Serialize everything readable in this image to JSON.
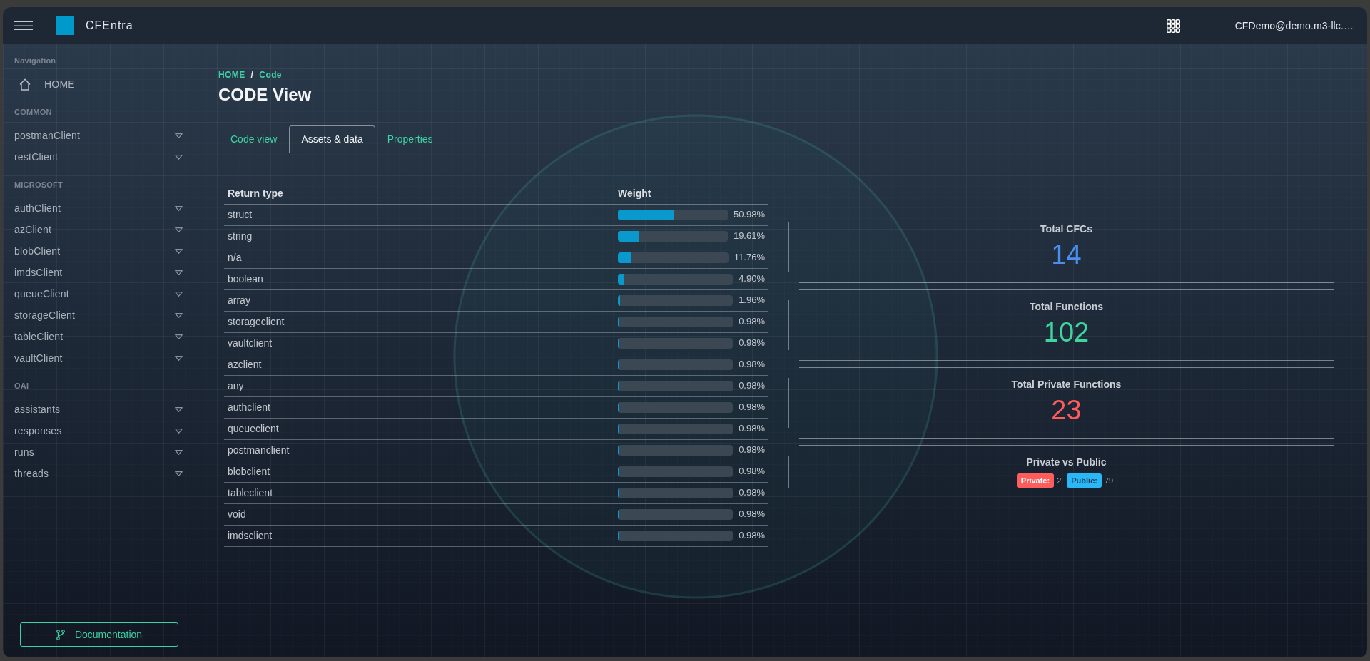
{
  "topbar": {
    "app_name": "CFEntra",
    "user": "CFDemo@demo.m3-llc.…"
  },
  "sidebar": {
    "sections": [
      {
        "heading": "Navigation",
        "items": [
          {
            "label": "HOME",
            "kind": "link"
          }
        ]
      },
      {
        "heading": "COMMON",
        "items": [
          {
            "label": "postmanClient",
            "kind": "dropdown"
          },
          {
            "label": "restClient",
            "kind": "dropdown"
          }
        ]
      },
      {
        "heading": "MICROSOFT",
        "items": [
          {
            "label": "authClient",
            "kind": "dropdown"
          },
          {
            "label": "azClient",
            "kind": "dropdown"
          },
          {
            "label": "blobClient",
            "kind": "dropdown"
          },
          {
            "label": "imdsClient",
            "kind": "dropdown"
          },
          {
            "label": "queueClient",
            "kind": "dropdown"
          },
          {
            "label": "storageClient",
            "kind": "dropdown"
          },
          {
            "label": "tableClient",
            "kind": "dropdown"
          },
          {
            "label": "vaultClient",
            "kind": "dropdown"
          }
        ]
      },
      {
        "heading": "OAI",
        "items": [
          {
            "label": "assistants",
            "kind": "dropdown"
          },
          {
            "label": "responses",
            "kind": "dropdown"
          },
          {
            "label": "runs",
            "kind": "dropdown"
          },
          {
            "label": "threads",
            "kind": "dropdown"
          }
        ]
      }
    ],
    "footer_button": "Documentation"
  },
  "breadcrumb": {
    "items": [
      "HOME",
      "Code"
    ],
    "separator": "/"
  },
  "page_title": "CODE View",
  "tabs": [
    {
      "label": "Code view",
      "selected": false
    },
    {
      "label": "Assets & data",
      "selected": true
    },
    {
      "label": "Properties",
      "selected": false
    }
  ],
  "table": {
    "columns": [
      "Return type",
      "Weight"
    ],
    "rows": [
      {
        "return_type": "struct",
        "weight": "50.98%",
        "level": 0.5098
      },
      {
        "return_type": "string",
        "weight": "19.61%",
        "level": 0.1961
      },
      {
        "return_type": "n/a",
        "weight": "11.76%",
        "level": 0.1176
      },
      {
        "return_type": "boolean",
        "weight": "4.90%",
        "level": 0.049
      },
      {
        "return_type": "array",
        "weight": "1.96%",
        "level": 0.0196
      },
      {
        "return_type": "storageclient",
        "weight": "0.98%",
        "level": 0.0098
      },
      {
        "return_type": "vaultclient",
        "weight": "0.98%",
        "level": 0.0098
      },
      {
        "return_type": "azclient",
        "weight": "0.98%",
        "level": 0.0098
      },
      {
        "return_type": "any",
        "weight": "0.98%",
        "level": 0.0098
      },
      {
        "return_type": "authclient",
        "weight": "0.98%",
        "level": 0.0098
      },
      {
        "return_type": "queueclient",
        "weight": "0.98%",
        "level": 0.0098
      },
      {
        "return_type": "postmanclient",
        "weight": "0.98%",
        "level": 0.0098
      },
      {
        "return_type": "blobclient",
        "weight": "0.98%",
        "level": 0.0098
      },
      {
        "return_type": "tableclient",
        "weight": "0.98%",
        "level": 0.0098
      },
      {
        "return_type": "void",
        "weight": "0.98%",
        "level": 0.0098
      },
      {
        "return_type": "imdsclient",
        "weight": "0.98%",
        "level": 0.0098
      }
    ]
  },
  "stats": [
    {
      "title": "Total CFCs",
      "value": "14",
      "color": "#4a8ff0"
    },
    {
      "title": "Total Functions",
      "value": "102",
      "color": "#3dd69e"
    },
    {
      "title": "Total Private Functions",
      "value": "23",
      "color": "#ff5b5b"
    }
  ],
  "legend_card": {
    "title": "Private vs Public",
    "items": [
      {
        "label": "Private:",
        "value": "2",
        "color": "#ff5c5c"
      },
      {
        "label": "Public:",
        "value": "79",
        "color": "#2ab7f5"
      }
    ]
  }
}
